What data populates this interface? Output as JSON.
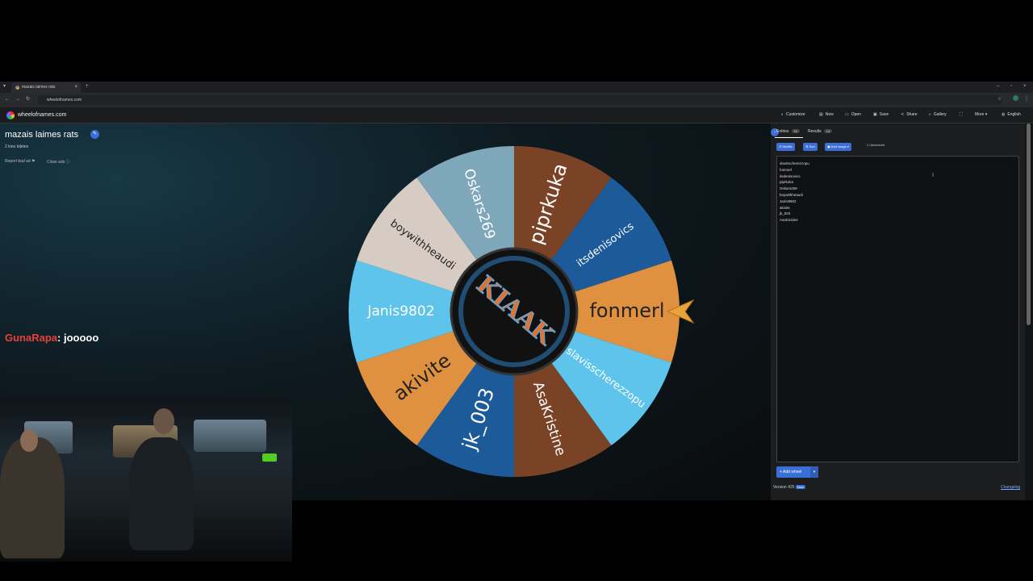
{
  "browser": {
    "tab_title": "mazais laimes rats",
    "tab_close": "×",
    "new_tab": "+",
    "url": "wheelofnames.com",
    "win_controls": [
      "–",
      "▫",
      "×"
    ]
  },
  "appbar": {
    "site": "wheelofnames.com",
    "menu": [
      {
        "icon": "palette-icon",
        "glyph": "◐",
        "label": "Customize"
      },
      {
        "icon": "new-icon",
        "glyph": "▤",
        "label": "New"
      },
      {
        "icon": "folder-icon",
        "glyph": "▭",
        "label": "Open"
      },
      {
        "icon": "save-icon",
        "glyph": "▣",
        "label": "Save"
      },
      {
        "icon": "share-icon",
        "glyph": "≺",
        "label": "Share"
      },
      {
        "icon": "search-icon",
        "glyph": "⌕",
        "label": "Gallery"
      },
      {
        "icon": "fullscreen-icon",
        "glyph": "⛶",
        "label": ""
      },
      {
        "icon": "more-icon",
        "glyph": "",
        "label": "More ▾"
      },
      {
        "icon": "globe-icon",
        "glyph": "◍",
        "label": "English"
      }
    ]
  },
  "page": {
    "title": "mazais laimes rats",
    "subtitle": "2 kino biļetes",
    "report": "Report bad ad",
    "close_ads": "Close ads"
  },
  "wheel": {
    "center_text": "KIAAK",
    "segments": [
      {
        "label": "fonmerl",
        "color": "#e0913f"
      },
      {
        "label": "slavisscherezzopu",
        "color": "#5fc4ec"
      },
      {
        "label": "AsaKristine",
        "color": "#7b4325"
      },
      {
        "label": "jk_003",
        "color": "#1c5a99"
      },
      {
        "label": "akivite",
        "color": "#e0913f"
      },
      {
        "label": "Janis9802",
        "color": "#5fc4ec"
      },
      {
        "label": "boywithheaudi",
        "color": "#d7ccc3"
      },
      {
        "label": "Oskars269",
        "color": "#7fa7ba"
      },
      {
        "label": "piprkuka",
        "color": "#7b4325"
      },
      {
        "label": "itsdenisovics",
        "color": "#1c5a99"
      }
    ]
  },
  "panel": {
    "tab_entries": "Entries",
    "entries_count": "10",
    "tab_results": "Results",
    "results_count": "14",
    "shuffle": "Shuffle",
    "sort": "Sort",
    "add_image": "Add image",
    "advanced": "Advanced",
    "entries": [
      "slavisscherezzopu",
      "fonmerl",
      "itsdenisovics",
      "piprkuka",
      "Oskars269",
      "boywithheaudi",
      "Janis9802",
      "akivite",
      "jk_003",
      "AsaKristine"
    ],
    "add_wheel": "Add wheel",
    "version": "Version 425",
    "version_badge": "New",
    "changelog": "Changelog"
  },
  "chat": {
    "user": "GunaRapa",
    "message": ": jooooo"
  }
}
